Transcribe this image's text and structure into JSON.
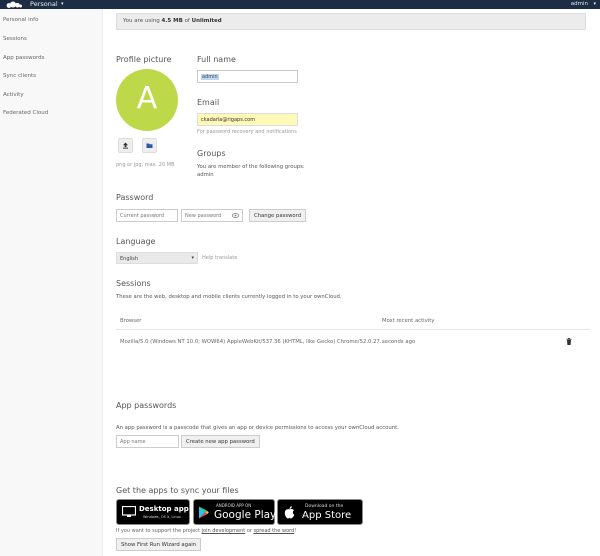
{
  "header": {
    "app_title": "Personal",
    "user": "admin"
  },
  "sidebar": {
    "items": [
      {
        "label": "Personal info"
      },
      {
        "label": "Sessions"
      },
      {
        "label": "App passwords"
      },
      {
        "label": "Sync clients"
      },
      {
        "label": "Activity"
      },
      {
        "label": "Federated Cloud"
      }
    ]
  },
  "quota": {
    "prefix": "You are using",
    "used": "4.5 MB",
    "of": "of",
    "total": "Unlimited"
  },
  "profile": {
    "heading": "Profile picture",
    "avatar_letter": "A",
    "avatar_color": "#bdd94a",
    "hint": "png or jpg, max. 20 MB"
  },
  "fullname": {
    "heading": "Full name",
    "value": "admin"
  },
  "email": {
    "heading": "Email",
    "value": "ckadarla@rigaps.com",
    "hint": "For password recovery and notifications"
  },
  "groups": {
    "heading": "Groups",
    "text": "You are member of the following groups:",
    "value": "admin"
  },
  "password": {
    "heading": "Password",
    "current_placeholder": "Current password",
    "new_placeholder": "New password",
    "button": "Change password"
  },
  "language": {
    "heading": "Language",
    "selected": "English",
    "help": "Help translate"
  },
  "sessions": {
    "heading": "Sessions",
    "description": "These are the web, desktop and mobile clients currently logged in to your ownCloud.",
    "columns": [
      "Browser",
      "Most recent activity"
    ],
    "rows": [
      {
        "browser": "Mozilla/5.0 (Windows NT 10.0; WOW64) AppleWebKit/537.36 (KHTML, like Gecko) Chrome/52.0.27...",
        "activity": "seconds ago"
      }
    ]
  },
  "app_passwords": {
    "heading": "App passwords",
    "description": "An app password is a passcode that gives an app or device permissions to access your ownCloud account.",
    "name_placeholder": "App name",
    "button": "Create new app password"
  },
  "sync": {
    "heading": "Get the apps to sync your files",
    "desktop_big": "Desktop app",
    "desktop_small": "Windows, OS X, Linux",
    "android_small": "ANDROID APP ON",
    "android_big": "Google Play",
    "ios_small": "Download on the",
    "ios_big": "App Store",
    "support_prefix": "If you want to support the project",
    "support_link1": "join development",
    "support_mid": "or",
    "support_link2": "spread the word",
    "support_suffix": "!",
    "wizard_button": "Show First Run Wizard again"
  }
}
